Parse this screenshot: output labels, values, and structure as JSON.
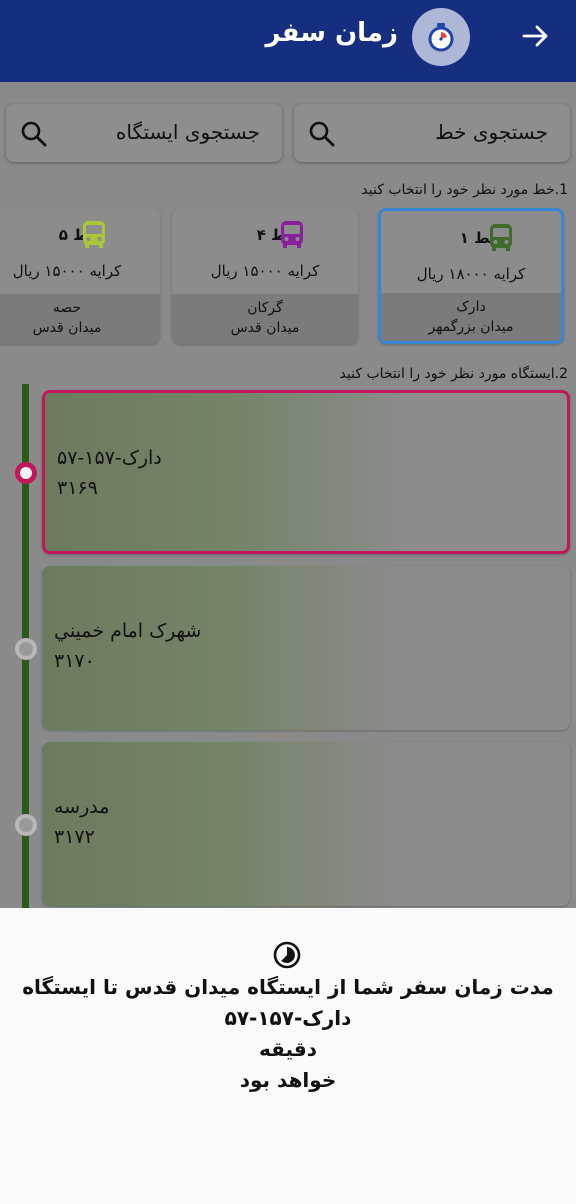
{
  "header": {
    "title": "زمان سفر",
    "back_icon": "arrow-right-icon",
    "logo_icon": "stopwatch-icon"
  },
  "search": {
    "line_label": "جستجوی خط",
    "station_label": "جستجوی ایستگاه"
  },
  "hints": {
    "select_line": "1.خط مورد نظر خود را انتخاب کنید",
    "select_station": "2.ایستگاه مورد نظر خود را انتخاب کنید"
  },
  "lines": [
    {
      "name": "خط ۱",
      "fare": "کرایه ۱۸۰۰۰ ریال",
      "from": "دارک",
      "to": "میدان بزرگمهر",
      "color": "#3f6b2a",
      "selected": true
    },
    {
      "name": "خط ۴",
      "fare": "کرایه ۱۵۰۰۰ ریال",
      "from": "گرکان",
      "to": "میدان قدس",
      "color": "#8a1f9e",
      "selected": false
    },
    {
      "name": "خط ۵",
      "fare": "کرایه ۱۵۰۰۰ ریال",
      "from": "حصه",
      "to": "میدان قدس",
      "color": "#a9c838",
      "selected": false
    }
  ],
  "stops": [
    {
      "name": "دارک-۱۵۷-۵۷",
      "code": "۳۱۶۹",
      "selected": true
    },
    {
      "name": "شهرک امام خميني",
      "code": "۳۱۷۰",
      "selected": false
    },
    {
      "name": "مدرسه",
      "code": "۳۱۷۲",
      "selected": false
    }
  ],
  "sheet": {
    "line1": "مدت زمان سفر شما از ایستگاه میدان قدس تا ایستگاه",
    "line2": "دارک-۱۵۷-۵۷",
    "line3": "دقیقه",
    "line4": "خواهد بود"
  },
  "colors": {
    "header": "#152e80",
    "accent_selected_line": "#3a86d6",
    "accent_selected_stop": "#c1185b",
    "timeline": "#2a5a1a"
  }
}
